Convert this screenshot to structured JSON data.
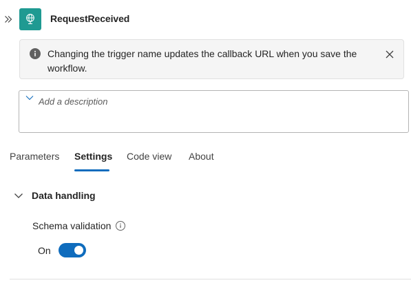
{
  "header": {
    "title": "RequestReceived"
  },
  "banner": {
    "message": "Changing the trigger name updates the callback URL when you save the workflow."
  },
  "description": {
    "placeholder": "Add a description"
  },
  "tabs": [
    {
      "label": "Parameters",
      "active": false
    },
    {
      "label": "Settings",
      "active": true
    },
    {
      "label": "Code view",
      "active": false
    },
    {
      "label": "About",
      "active": false
    }
  ],
  "section": {
    "title": "Data handling",
    "fields": [
      {
        "label": "Schema validation",
        "toggle_label": "On",
        "enabled": true
      }
    ]
  },
  "colors": {
    "accent": "#0f6cbd",
    "app_icon_bg": "#1f9a92",
    "banner_bg": "#f5f5f5"
  }
}
